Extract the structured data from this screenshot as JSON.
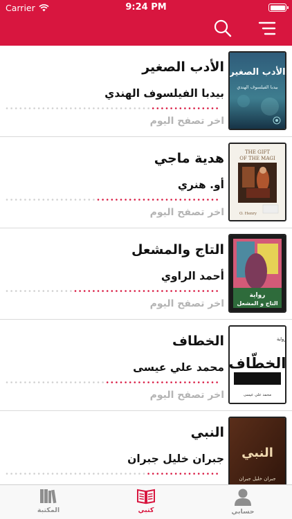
{
  "status_bar": {
    "carrier": "Carrier",
    "time": "9:24 PM"
  },
  "colors": {
    "accent": "#d8163f",
    "inactive": "#8e8e8e",
    "muted_text": "#b4b4b4"
  },
  "header": {
    "icons": [
      "search-icon",
      "menu-icon"
    ]
  },
  "books": [
    {
      "title": "الأدب الصغير",
      "author": "بيدبا الفيلسوف الهندي",
      "last_read": "اخر تصفح اليوم",
      "progress": 0.32,
      "cover_lines": [
        "الأدب الصغير",
        "بيدبا الفيلسوف الهندي"
      ]
    },
    {
      "title": "هدية ماجي",
      "author": "أو. هنري",
      "last_read": "اخر تصفح اليوم",
      "progress": 0.58,
      "cover_lines": [
        "THE GIFT",
        "OF THE MAGI",
        "O. Henry"
      ]
    },
    {
      "title": "التاج والمشعل",
      "author": "أحمد الراوي",
      "last_read": "اخر تصفح اليوم",
      "progress": 0.68,
      "cover_lines": [
        "رواية",
        "التاج و المشعل"
      ]
    },
    {
      "title": "الخطاف",
      "author": "محمد علي عيسى",
      "last_read": "اخر تصفح اليوم",
      "progress": 0.53,
      "cover_lines": [
        "رواية",
        "الخطّاف",
        "محمد علي عيسى"
      ]
    },
    {
      "title": "النبي",
      "author": "جبران خليل جبران",
      "last_read": "",
      "progress": 0.35,
      "cover_lines": [
        "النبي",
        "جبران خليل جبران"
      ]
    }
  ],
  "tabs": [
    {
      "label": "المكتبة",
      "icon": "books-icon",
      "active": false
    },
    {
      "label": "كتبي",
      "icon": "open-book-icon",
      "active": true
    },
    {
      "label": "حسابي",
      "icon": "person-icon",
      "active": false
    }
  ]
}
